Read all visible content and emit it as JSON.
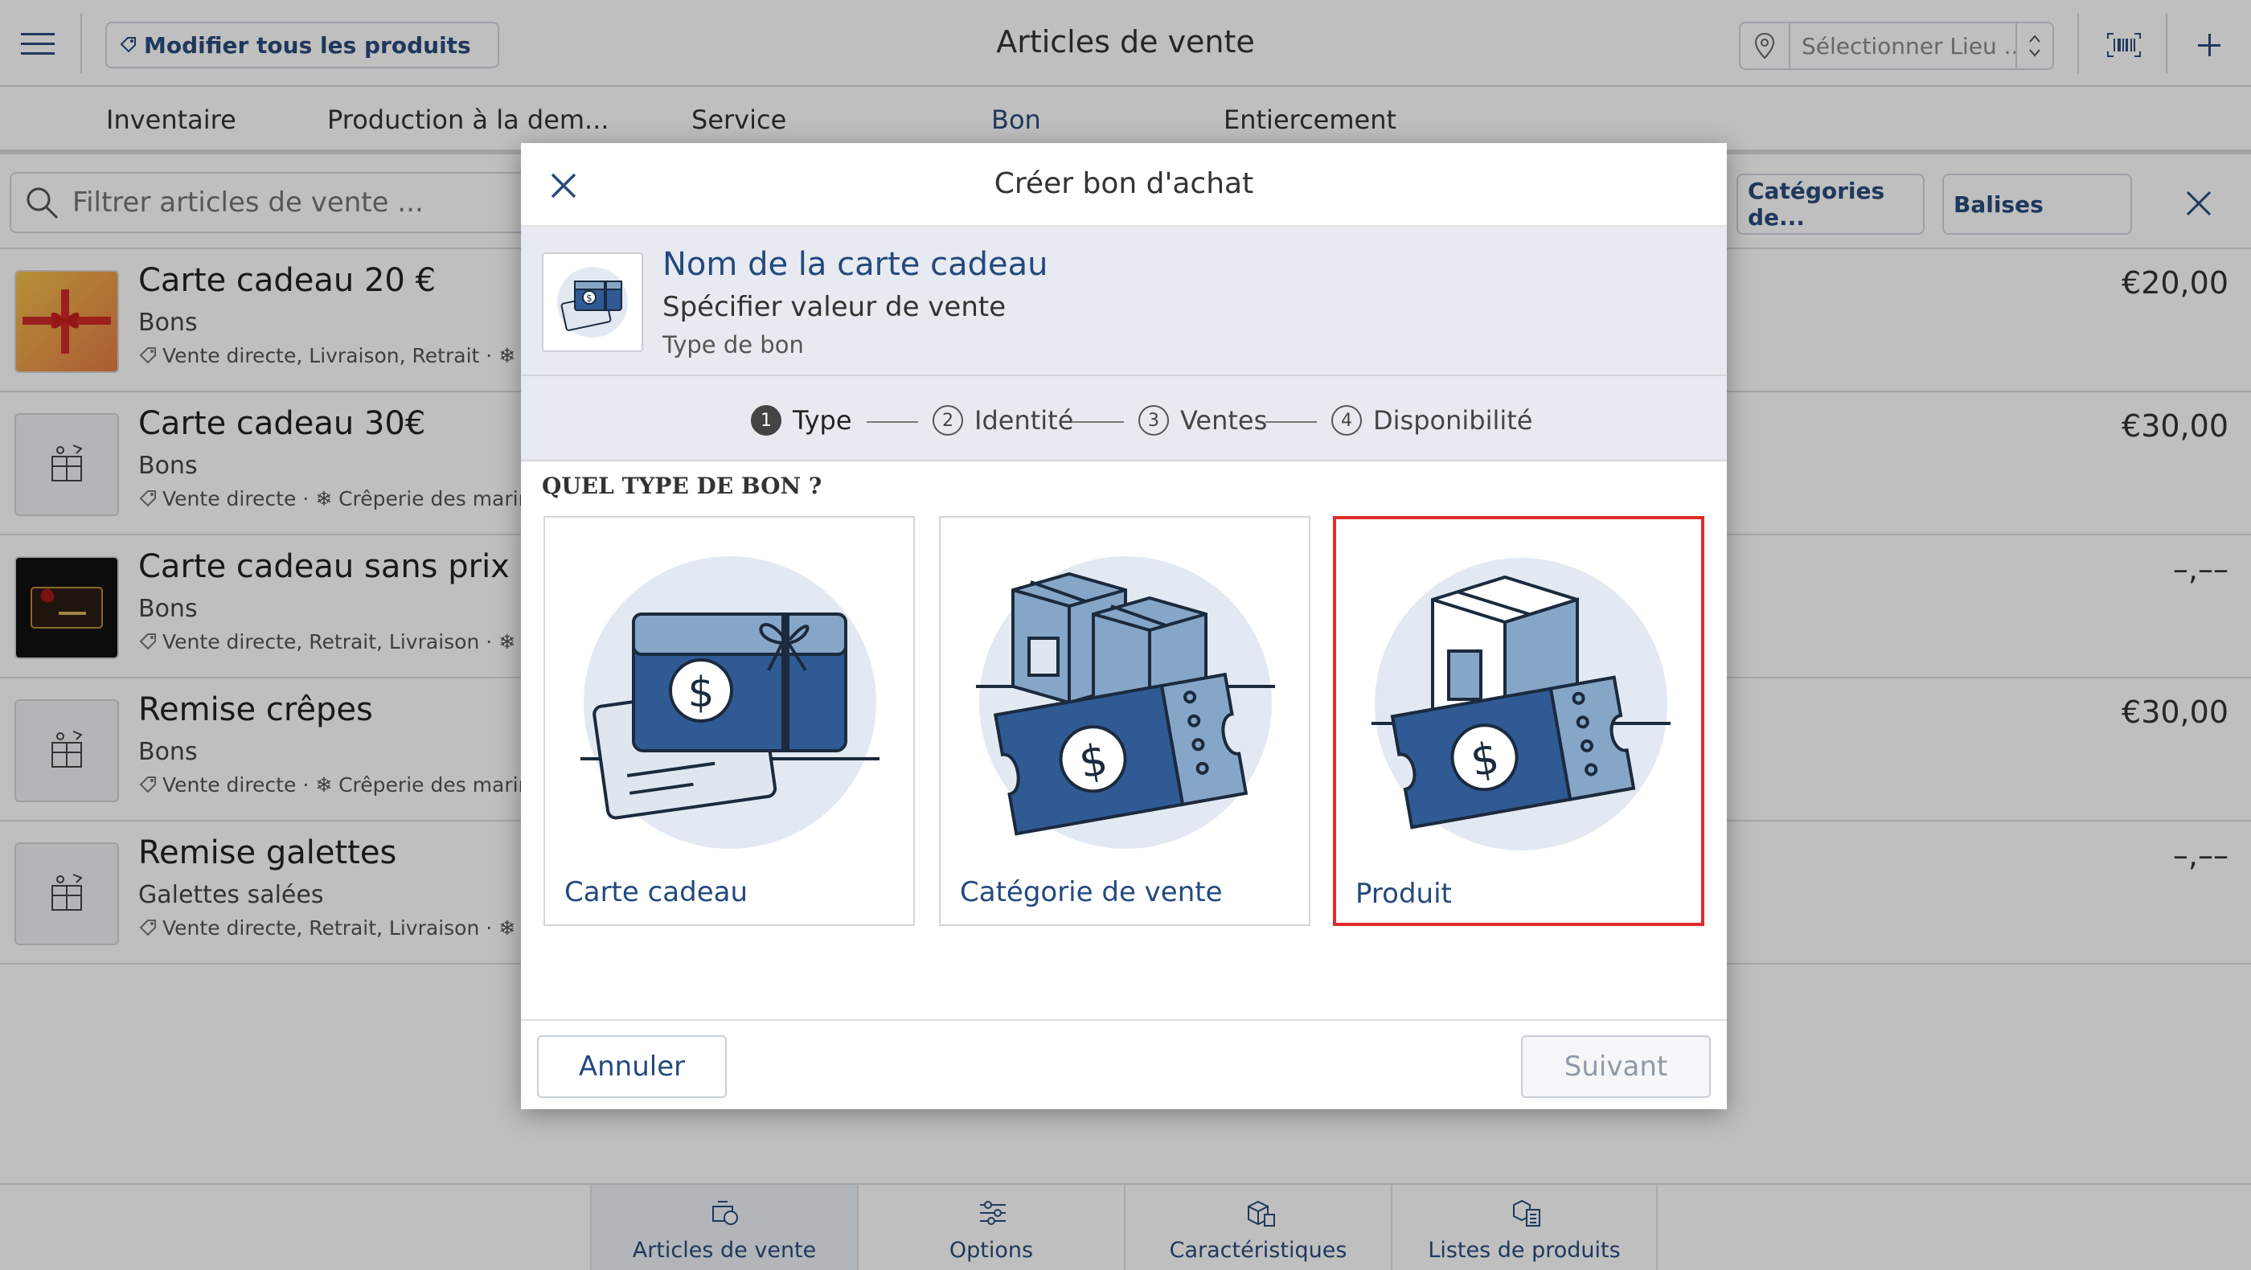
{
  "header": {
    "edit_all_label": "Modifier tous les produits",
    "title": "Articles de vente",
    "location_placeholder": "Sélectionner Lieu ......"
  },
  "tabs": [
    {
      "label": "Inventaire"
    },
    {
      "label": "Production à la dem..."
    },
    {
      "label": "Service"
    },
    {
      "label": "Bon"
    },
    {
      "label": "Entiercement"
    }
  ],
  "filter": {
    "search_placeholder": "Filtrer articles de vente ...",
    "categories_label": "Catégories de...",
    "tags_label": "Balises"
  },
  "items": [
    {
      "name": "Carte cadeau 20 €",
      "category": "Bons",
      "channels": "Vente directe, Livraison, Retrait · ❄ Cr",
      "price": "€20,00"
    },
    {
      "name": "Carte cadeau 30€",
      "category": "Bons",
      "channels": "Vente directe · ❄ Crêperie des marins",
      "price": "€30,00"
    },
    {
      "name": "Carte cadeau sans prix",
      "category": "Bons",
      "channels": "Vente directe, Retrait, Livraison · ❄ Cr",
      "price": "–,––"
    },
    {
      "name": "Remise crêpes",
      "category": "Bons",
      "channels": "Vente directe · ❄ Crêperie des marins",
      "price": "€30,00"
    },
    {
      "name": "Remise galettes",
      "category": "Galettes salées",
      "channels": "Vente directe, Retrait, Livraison · ❄ Cr",
      "price": "–,––"
    }
  ],
  "bottom_nav": [
    {
      "label": "Articles de vente"
    },
    {
      "label": "Options"
    },
    {
      "label": "Caractéristiques"
    },
    {
      "label": "Listes de produits"
    }
  ],
  "modal": {
    "title": "Créer bon d'achat",
    "gift_name": "Nom de la carte cadeau",
    "gift_value": "Spécifier valeur de vente",
    "gift_type": "Type de bon",
    "steps": [
      {
        "num": "1",
        "label": "Type"
      },
      {
        "num": "2",
        "label": "Identité"
      },
      {
        "num": "3",
        "label": "Ventes"
      },
      {
        "num": "4",
        "label": "Disponibilité"
      }
    ],
    "question": "QUEL TYPE DE BON ?",
    "options": [
      {
        "label": "Carte cadeau"
      },
      {
        "label": "Catégorie de vente"
      },
      {
        "label": "Produit"
      }
    ],
    "cancel_label": "Annuler",
    "next_label": "Suivant"
  },
  "colors": {
    "accent": "#24497e",
    "selected_border": "#e02c2c",
    "illustration_dark": "#2f5a94",
    "illustration_light": "#86a6c8",
    "illustration_bg": "#e3e9f2"
  }
}
